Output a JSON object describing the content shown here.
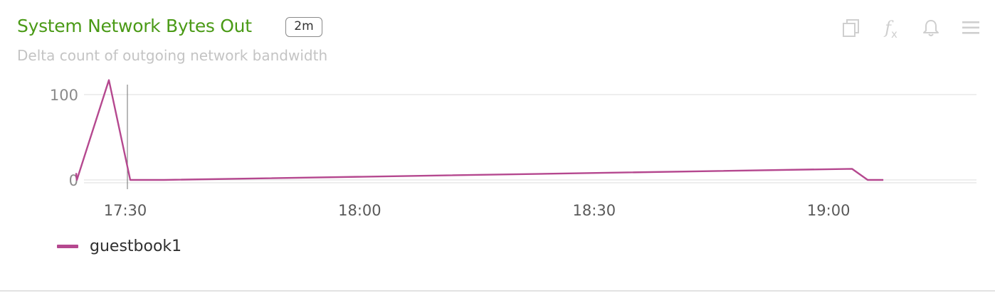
{
  "widget": {
    "title": "System Network Bytes Out",
    "time_badge": "2m",
    "subtitle": "Delta count of outgoing network bandwidth",
    "title_color": "#4a9a16"
  },
  "toolbar": {
    "icons": [
      "copy-icon",
      "fx-icon",
      "bell-icon",
      "menu-icon"
    ],
    "fx_label": "f",
    "fx_sub": "x"
  },
  "chart_data": {
    "type": "line",
    "title": "",
    "xlabel": "",
    "ylabel": "",
    "x_tick_labels": [
      "17:30",
      "18:00",
      "18:30",
      "19:00"
    ],
    "y_tick_labels": [
      "0",
      "100"
    ],
    "ylim": [
      -5,
      120
    ],
    "grid": true,
    "legend_position": "bottom-left",
    "cursor_time": "17:30",
    "series": [
      {
        "name": "guestbook1",
        "color": "#b5488f",
        "points": [
          {
            "t": "17:29",
            "v": 8
          },
          {
            "t": "17:29",
            "v": 0
          },
          {
            "t": "17:29",
            "v": 117
          },
          {
            "t": "17:30",
            "v": 0
          },
          {
            "t": "17:35",
            "v": 0
          },
          {
            "t": "19:03",
            "v": 13
          },
          {
            "t": "19:05",
            "v": 0
          },
          {
            "t": "19:07",
            "v": 0
          }
        ]
      }
    ]
  }
}
